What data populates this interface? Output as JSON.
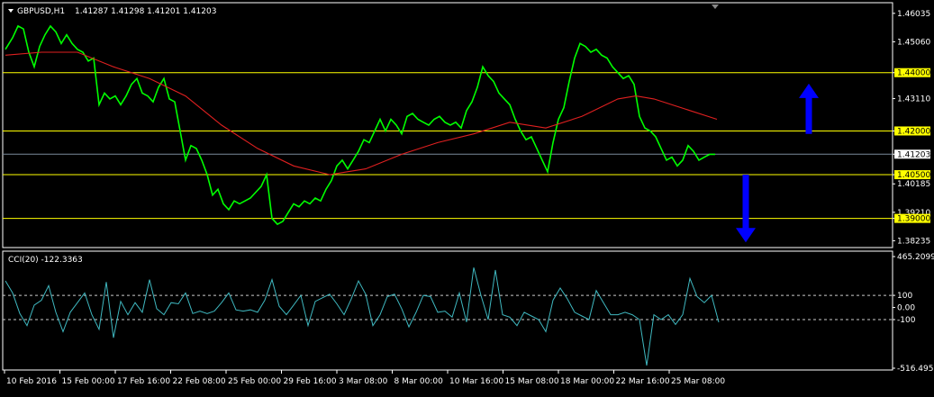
{
  "header": {
    "symbol": "GBPUSD,H1",
    "ohlc": "1.41287 1.41298 1.41201 1.41203",
    "cci_label": "CCI(20) -122.3363"
  },
  "chart_data": [
    {
      "type": "line",
      "series": [
        {
          "name": "",
          "color": "#00ff00",
          "x": [
            0,
            8,
            14,
            20,
            26,
            32,
            38,
            44,
            50,
            56,
            62,
            68,
            74,
            80,
            86,
            92,
            98,
            104,
            110,
            116,
            122,
            128,
            134,
            140,
            146,
            152,
            158,
            164,
            170,
            176,
            182,
            188,
            194,
            200,
            206,
            212,
            218,
            224,
            230,
            236,
            242,
            248,
            254,
            260,
            266,
            272,
            278,
            284,
            290,
            296,
            302,
            308,
            314,
            320,
            326,
            332,
            338,
            344,
            350,
            356,
            362,
            368,
            374,
            380,
            386,
            392,
            398,
            404,
            410,
            416,
            422,
            428,
            434,
            440,
            446,
            452,
            458,
            464,
            470,
            476,
            482,
            488,
            494,
            500,
            506,
            512,
            518,
            524,
            530,
            536,
            542,
            548,
            554,
            560,
            566,
            572,
            578,
            584,
            590,
            596,
            602,
            608,
            614,
            620,
            626,
            632,
            638,
            644,
            650,
            656,
            662,
            668,
            674,
            680,
            686,
            692,
            698,
            704,
            710,
            716,
            722,
            728,
            734,
            740,
            746,
            752,
            758,
            764,
            770,
            776,
            782,
            788
          ],
          "y": [
            1.448,
            1.452,
            1.456,
            1.455,
            1.447,
            1.442,
            1.449,
            1.453,
            1.456,
            1.454,
            1.45,
            1.453,
            1.45,
            1.448,
            1.447,
            1.444,
            1.445,
            1.429,
            1.433,
            1.431,
            1.432,
            1.429,
            1.432,
            1.436,
            1.438,
            1.433,
            1.432,
            1.43,
            1.435,
            1.438,
            1.431,
            1.43,
            1.42,
            1.41,
            1.415,
            1.414,
            1.41,
            1.405,
            1.398,
            1.4,
            1.395,
            1.393,
            1.396,
            1.395,
            1.396,
            1.397,
            1.399,
            1.401,
            1.405,
            1.39,
            1.388,
            1.389,
            1.392,
            1.395,
            1.394,
            1.396,
            1.395,
            1.397,
            1.396,
            1.4,
            1.403,
            1.408,
            1.41,
            1.407,
            1.41,
            1.413,
            1.417,
            1.416,
            1.42,
            1.424,
            1.42,
            1.424,
            1.422,
            1.419,
            1.425,
            1.426,
            1.424,
            1.423,
            1.422,
            1.424,
            1.425,
            1.423,
            1.422,
            1.423,
            1.421,
            1.427,
            1.43,
            1.435,
            1.442,
            1.439,
            1.437,
            1.433,
            1.431,
            1.429,
            1.424,
            1.42,
            1.417,
            1.418,
            1.414,
            1.41,
            1.406,
            1.416,
            1.424,
            1.428,
            1.437,
            1.445,
            1.45,
            1.449,
            1.447,
            1.448,
            1.446,
            1.445,
            1.442,
            1.44,
            1.438,
            1.439,
            1.436,
            1.425,
            1.421,
            1.42,
            1.418,
            1.414,
            1.41,
            1.411,
            1.408,
            1.41,
            1.415,
            1.413,
            1.41,
            1.411,
            1.412,
            1.412
          ]
        },
        {
          "name": "",
          "color": "#e02020",
          "x": [
            0,
            40,
            80,
            120,
            160,
            200,
            240,
            280,
            320,
            360,
            400,
            440,
            480,
            520,
            560,
            600,
            640,
            680,
            700,
            720,
            760,
            790
          ],
          "y": [
            1.446,
            1.447,
            1.447,
            1.442,
            1.438,
            1.432,
            1.422,
            1.414,
            1.408,
            1.405,
            1.407,
            1.412,
            1.416,
            1.419,
            1.423,
            1.421,
            1.425,
            1.431,
            1.432,
            1.431,
            1.427,
            1.424
          ]
        }
      ],
      "ylim": [
        1.38,
        1.464
      ],
      "ticks": [
        "1.46035",
        "1.45060",
        "1.44000",
        "1.43110",
        "1.42000",
        "1.41203",
        "1.40500",
        "1.40185",
        "1.39210",
        "1.39000",
        "1.38235"
      ],
      "tick_values": [
        1.46035,
        1.4506,
        1.44,
        1.4311,
        1.42,
        1.41203,
        1.405,
        1.40185,
        1.3921,
        1.39,
        1.38235
      ],
      "highlight_ticks": [
        "1.44000",
        "1.42000",
        "1.40500",
        "1.39000"
      ],
      "current_price": "1.41203",
      "levels": [
        1.44,
        1.42,
        1.405,
        1.39
      ],
      "level_color": "#ffff00",
      "arrows": [
        {
          "direction": "up",
          "x": 898,
          "y_from": 1.419,
          "y_to": 1.435,
          "color": "#0000ff"
        },
        {
          "direction": "down",
          "x": 828,
          "y_from": 1.405,
          "y_to": 1.383,
          "color": "#0000ff"
        }
      ],
      "x_ticks": [
        "10 Feb 2016",
        "15 Feb 00:00",
        "17 Feb 16:00",
        "22 Feb 08:00",
        "25 Feb 00:00",
        "29 Feb 16:00",
        "3 Mar 08:00",
        "8 Mar 00:00",
        "10 Mar 16:00",
        "15 Mar 08:00",
        "18 Mar 00:00",
        "22 Mar 16:00",
        "25 Mar 08:00"
      ],
      "grid": false,
      "legend": "none"
    },
    {
      "type": "line",
      "series": [
        {
          "name": "",
          "color": "#3fb8c0",
          "x": [
            0,
            8,
            16,
            24,
            32,
            40,
            48,
            56,
            64,
            72,
            80,
            88,
            96,
            104,
            112,
            120,
            128,
            136,
            144,
            152,
            160,
            168,
            176,
            184,
            192,
            200,
            208,
            216,
            224,
            232,
            240,
            248,
            256,
            264,
            272,
            280,
            288,
            296,
            304,
            312,
            320,
            328,
            336,
            344,
            352,
            360,
            368,
            376,
            384,
            392,
            400,
            408,
            416,
            424,
            432,
            440,
            448,
            456,
            464,
            472,
            480,
            488,
            496,
            504,
            512,
            520,
            528,
            536,
            544,
            552,
            560,
            568,
            576,
            584,
            592,
            600,
            608,
            616,
            624,
            632,
            640,
            648,
            656,
            664,
            672,
            680,
            688,
            696,
            704,
            712,
            720,
            728,
            736,
            744,
            752,
            760,
            768,
            776,
            784,
            792
          ],
          "y": [
            220,
            120,
            -50,
            -150,
            20,
            60,
            180,
            -40,
            -200,
            -40,
            40,
            120,
            -60,
            -180,
            210,
            -250,
            50,
            -60,
            40,
            -40,
            230,
            -10,
            -60,
            40,
            30,
            120,
            -50,
            -30,
            -50,
            -30,
            40,
            120,
            -20,
            -30,
            -20,
            -40,
            60,
            230,
            10,
            -60,
            20,
            100,
            -150,
            50,
            80,
            110,
            30,
            -60,
            70,
            220,
            110,
            -150,
            -60,
            90,
            110,
            -10,
            -160,
            -40,
            100,
            90,
            -40,
            -30,
            -80,
            120,
            -120,
            330,
            100,
            -100,
            310,
            -60,
            -80,
            -150,
            -40,
            -70,
            -100,
            -200,
            60,
            160,
            70,
            -40,
            -70,
            -100,
            140,
            40,
            -60,
            -60,
            -40,
            -60,
            -100,
            -480,
            -60,
            -100,
            -60,
            -140,
            -60,
            240,
            90,
            40,
            100,
            -122
          ]
        }
      ],
      "ylim": [
        -516.4956,
        465.2099
      ],
      "ticks": [
        "465.2099",
        "100",
        "0.00",
        "-100",
        "-516.4956"
      ],
      "tick_values": [
        465.2099,
        100,
        0,
        -100,
        -516.4956
      ],
      "levels": [
        100,
        -100
      ],
      "grid": false,
      "legend": "none"
    }
  ]
}
